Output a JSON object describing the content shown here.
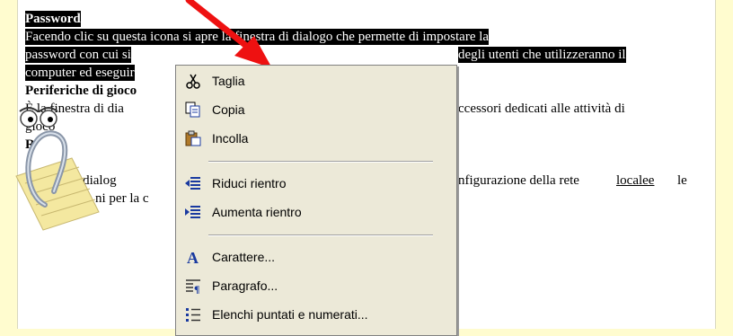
{
  "document": {
    "lines": [
      "Password",
      "Facendo clic su questa icona si apre la finestra di dialogo che permette di impostare la",
      "password con cui si",
      "degli utenti che utilizzeranno il",
      "computer ed eseguir",
      "Periferiche di gioco",
      "È la finestra di dia",
      "ccessori dedicati alle attività di",
      "gioco",
      "R",
      "ii dialog",
      "nfigurazione della rete",
      "localee",
      "le",
      "ni per la c"
    ]
  },
  "context_menu": {
    "items": [
      {
        "label": "Taglia",
        "icon": "scissors-icon"
      },
      {
        "label": "Copia",
        "icon": "copy-icon"
      },
      {
        "label": "Incolla",
        "icon": "paste-icon"
      },
      {
        "label": "Riduci rientro",
        "icon": "decrease-indent-icon"
      },
      {
        "label": "Aumenta rientro",
        "icon": "increase-indent-icon"
      },
      {
        "label": "Carattere...",
        "icon": "font-icon"
      },
      {
        "label": "Paragrafo...",
        "icon": "paragraph-icon"
      },
      {
        "label": "Elenchi puntati e numerati...",
        "icon": "bullets-numbering-icon"
      }
    ]
  },
  "colors": {
    "page_bg": "#fffccf",
    "menu_bg": "#ece9d8",
    "arrow": "#ee1111",
    "highlight": "#000000"
  }
}
